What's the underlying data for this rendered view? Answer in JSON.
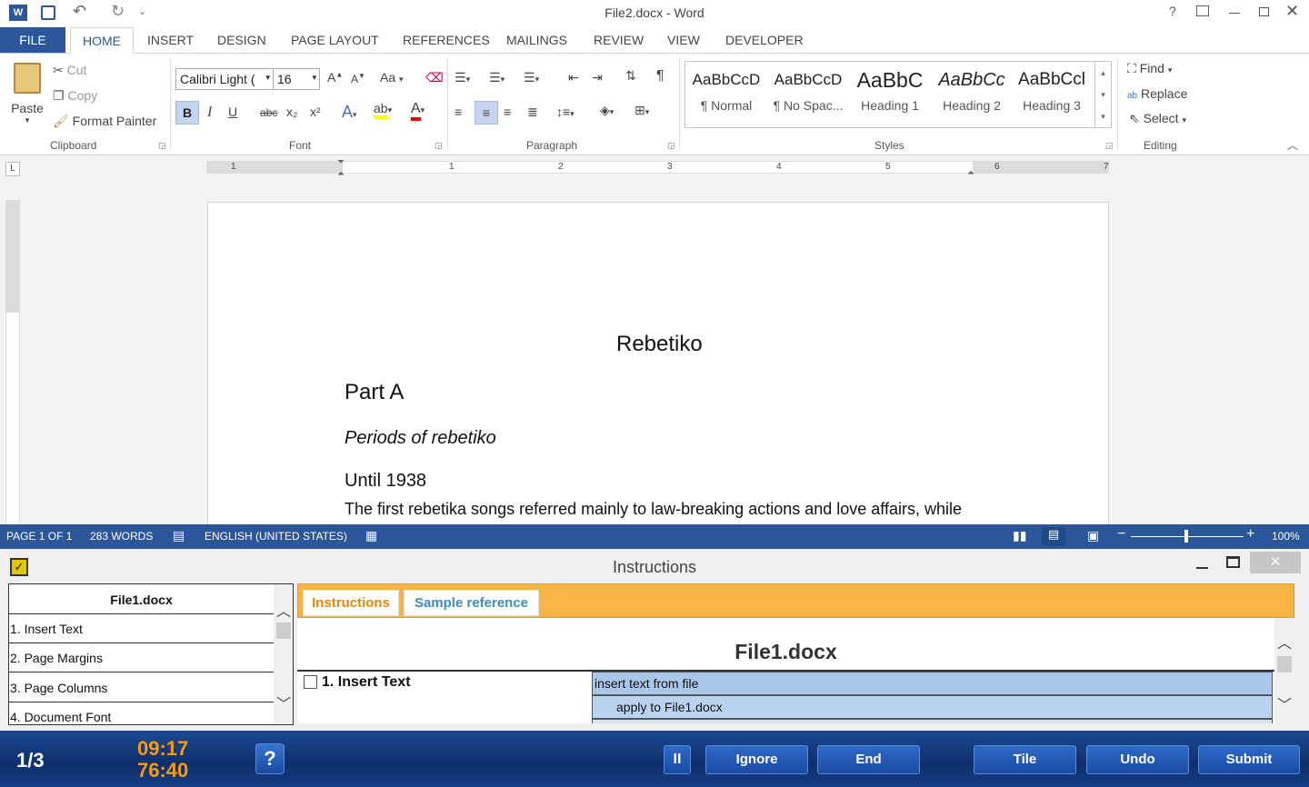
{
  "titlebar": {
    "title": "File2.docx - Word",
    "app_icon": "word-icon",
    "help": "?",
    "qat_more": "⌄"
  },
  "ribbon_tabs": [
    "FILE",
    "HOME",
    "INSERT",
    "DESIGN",
    "PAGE LAYOUT",
    "REFERENCES",
    "MAILINGS",
    "REVIEW",
    "VIEW",
    "DEVELOPER"
  ],
  "clipboard": {
    "paste": "Paste",
    "cut": "Cut",
    "copy": "Copy",
    "format_painter": "Format Painter",
    "label": "Clipboard"
  },
  "font": {
    "name": "Calibri Light (",
    "size": "16",
    "label": "Font",
    "bold": "B",
    "italic": "I",
    "underline": "U",
    "strike": "abc",
    "sub": "x₂",
    "sup": "x²",
    "case": "Aa"
  },
  "paragraph": {
    "label": "Paragraph"
  },
  "styles": {
    "label": "Styles",
    "items": [
      {
        "preview": "AaBbCcD",
        "name": "¶ Normal"
      },
      {
        "preview": "AaBbCcD",
        "name": "¶ No Spac..."
      },
      {
        "preview": "AaBbC",
        "name": "Heading 1"
      },
      {
        "preview": "AaBbCc",
        "name": "Heading 2"
      },
      {
        "preview": "AaBbCcl",
        "name": "Heading 3"
      }
    ]
  },
  "editing": {
    "find": "Find",
    "replace": "Replace",
    "select": "Select",
    "label": "Editing"
  },
  "ruler": {
    "numbers": [
      "1",
      "1",
      "2",
      "3",
      "4",
      "5",
      "6",
      "7"
    ],
    "corner": "L"
  },
  "document": {
    "title": "Rebetiko",
    "part": "Part A",
    "subtitle": "Periods of rebetiko",
    "heading": "Until 1938",
    "body": "The first rebetika songs referred mainly to law-breaking actions and love affairs, while"
  },
  "status": {
    "page": "PAGE 1 OF 1",
    "words": "283 WORDS",
    "language": "ENGLISH (UNITED STATES)",
    "zoom": "100%"
  },
  "instructions": {
    "title": "Instructions",
    "list_header": "File1.docx",
    "list": [
      "1. Insert Text",
      "2. Page Margins",
      "3. Page Columns",
      "4. Document Font"
    ],
    "tab_instructions": "Instructions",
    "tab_sample": "Sample reference",
    "heading": "File1.docx",
    "task": "1. Insert Text",
    "row1": "insert text from file",
    "row2": "apply to File1.docx"
  },
  "bottom": {
    "counter": "1/3",
    "time1": "09:17",
    "time2": "76:40",
    "help": "?",
    "pause": "II",
    "ignore": "Ignore",
    "end": "End",
    "tile": "Tile",
    "undo": "Undo",
    "submit": "Submit"
  },
  "colors": {
    "accent": "#2b579a",
    "orange": "#f7b343",
    "timer": "#f39c12"
  }
}
